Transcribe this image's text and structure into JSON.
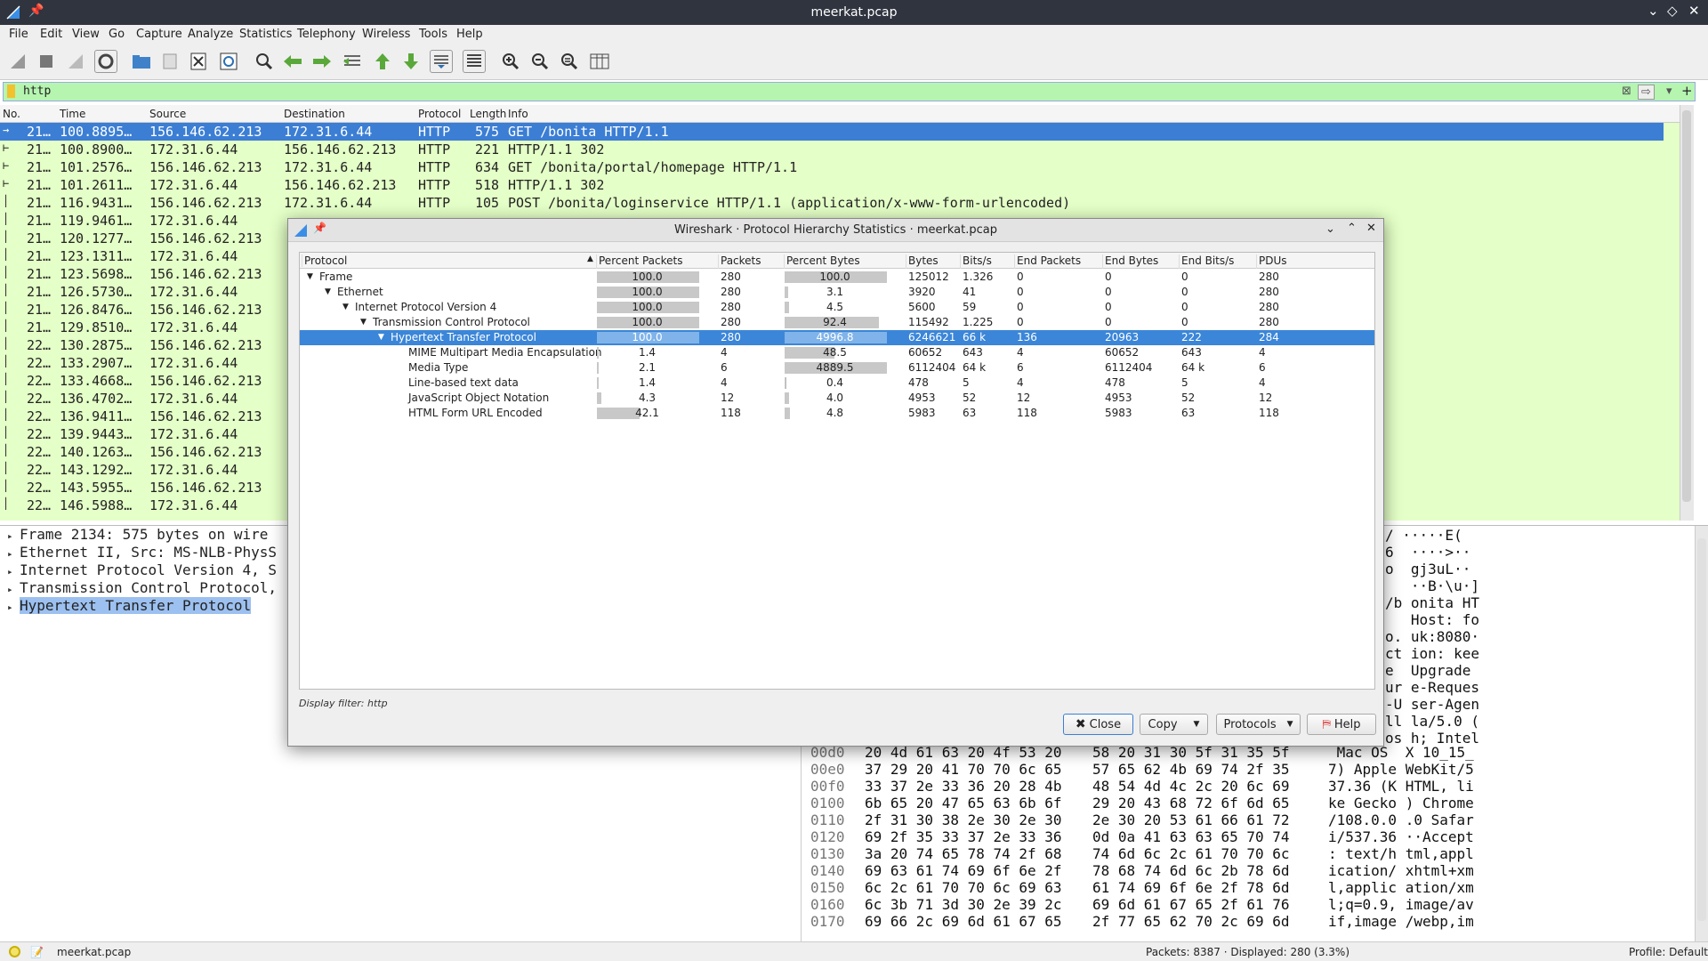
{
  "window": {
    "title": "meerkat.pcap"
  },
  "menu": [
    "File",
    "Edit",
    "View",
    "Go",
    "Capture",
    "Analyze",
    "Statistics",
    "Telephony",
    "Wireless",
    "Tools",
    "Help"
  ],
  "filter": {
    "value": "http"
  },
  "packet_list": {
    "columns": [
      "No.",
      "Time",
      "Source",
      "Destination",
      "Protocol",
      "Length",
      "Info"
    ],
    "rows": [
      {
        "no": "21…",
        "time": "100.8895…",
        "src": "156.146.62.213",
        "dst": "172.31.6.44",
        "proto": "HTTP",
        "len": "575",
        "info": "GET /bonita HTTP/1.1"
      },
      {
        "no": "21…",
        "time": "100.8900…",
        "src": "172.31.6.44",
        "dst": "156.146.62.213",
        "proto": "HTTP",
        "len": "221",
        "info": "HTTP/1.1 302"
      },
      {
        "no": "21…",
        "time": "101.2576…",
        "src": "156.146.62.213",
        "dst": "172.31.6.44",
        "proto": "HTTP",
        "len": "634",
        "info": "GET /bonita/portal/homepage HTTP/1.1"
      },
      {
        "no": "21…",
        "time": "101.2611…",
        "src": "172.31.6.44",
        "dst": "156.146.62.213",
        "proto": "HTTP",
        "len": "518",
        "info": "HTTP/1.1 302"
      },
      {
        "no": "21…",
        "time": "116.9431…",
        "src": "156.146.62.213",
        "dst": "172.31.6.44",
        "proto": "HTTP",
        "len": "105",
        "info": "POST /bonita/loginservice HTTP/1.1  (application/x-www-form-urlencoded)"
      },
      {
        "no": "21…",
        "time": "119.9461…",
        "src": "172.31.6.44",
        "dst": "",
        "proto": "",
        "len": "",
        "info": ""
      },
      {
        "no": "21…",
        "time": "120.1277…",
        "src": "156.146.62.213",
        "dst": "",
        "proto": "",
        "len": "",
        "info": ""
      },
      {
        "no": "21…",
        "time": "123.1311…",
        "src": "172.31.6.44",
        "dst": "",
        "proto": "",
        "len": "",
        "info": ""
      },
      {
        "no": "21…",
        "time": "123.5698…",
        "src": "156.146.62.213",
        "dst": "",
        "proto": "",
        "len": "",
        "info": ""
      },
      {
        "no": "21…",
        "time": "126.5730…",
        "src": "172.31.6.44",
        "dst": "",
        "proto": "",
        "len": "",
        "info": ""
      },
      {
        "no": "21…",
        "time": "126.8476…",
        "src": "156.146.62.213",
        "dst": "",
        "proto": "",
        "len": "",
        "info": ""
      },
      {
        "no": "21…",
        "time": "129.8510…",
        "src": "172.31.6.44",
        "dst": "",
        "proto": "",
        "len": "",
        "info": ""
      },
      {
        "no": "22…",
        "time": "130.2875…",
        "src": "156.146.62.213",
        "dst": "",
        "proto": "",
        "len": "",
        "info": ""
      },
      {
        "no": "22…",
        "time": "133.2907…",
        "src": "172.31.6.44",
        "dst": "",
        "proto": "",
        "len": "",
        "info": ""
      },
      {
        "no": "22…",
        "time": "133.4668…",
        "src": "156.146.62.213",
        "dst": "",
        "proto": "",
        "len": "",
        "info": ""
      },
      {
        "no": "22…",
        "time": "136.4702…",
        "src": "172.31.6.44",
        "dst": "",
        "proto": "",
        "len": "",
        "info": ""
      },
      {
        "no": "22…",
        "time": "136.9411…",
        "src": "156.146.62.213",
        "dst": "",
        "proto": "",
        "len": "",
        "info": ""
      },
      {
        "no": "22…",
        "time": "139.9443…",
        "src": "172.31.6.44",
        "dst": "",
        "proto": "",
        "len": "",
        "info": ""
      },
      {
        "no": "22…",
        "time": "140.1263…",
        "src": "156.146.62.213",
        "dst": "",
        "proto": "",
        "len": "",
        "info": ""
      },
      {
        "no": "22…",
        "time": "143.1292…",
        "src": "172.31.6.44",
        "dst": "",
        "proto": "",
        "len": "",
        "info": ""
      },
      {
        "no": "22…",
        "time": "143.5955…",
        "src": "156.146.62.213",
        "dst": "",
        "proto": "",
        "len": "",
        "info": ""
      },
      {
        "no": "22…",
        "time": "146.5988…",
        "src": "172.31.6.44",
        "dst": "",
        "proto": "",
        "len": "",
        "info": ""
      }
    ]
  },
  "details": [
    "Frame 2134: 575 bytes on wire",
    "Ethernet II, Src: MS-NLB-PhysS",
    "Internet Protocol Version 4, S",
    "Transmission Control Protocol,",
    "Hypertext Transfer Protocol"
  ],
  "hex_partial": [
    {
      "ascii": "/ ·····E("
    },
    {
      "ascii": "6  ····>··"
    },
    {
      "ascii": "o  gj3uL··"
    },
    {
      "ascii": "   ··B·\\u·]"
    },
    {
      "ascii": "/b onita HT"
    },
    {
      "ascii": "   Host: fo"
    },
    {
      "ascii": "o. uk:8080·"
    },
    {
      "ascii": "ct ion: kee"
    },
    {
      "ascii": "e  Upgrade"
    },
    {
      "ascii": "ur e-Reques"
    },
    {
      "ascii": "-U ser-Agen"
    },
    {
      "ascii": "ll la/5.0 ("
    },
    {
      "ascii": "os h; Intel"
    }
  ],
  "hex": [
    {
      "off": "00d0",
      "b1": "20 4d 61 63 20 4f 53 20",
      "b2": "58 20 31 30 5f 31 35 5f",
      "ascii": " Mac OS  X 10_15_"
    },
    {
      "off": "00e0",
      "b1": "37 29 20 41 70 70 6c 65",
      "b2": "57 65 62 4b 69 74 2f 35",
      "ascii": "7) Apple WebKit/5"
    },
    {
      "off": "00f0",
      "b1": "33 37 2e 33 36 20 28 4b",
      "b2": "48 54 4d 4c 2c 20 6c 69",
      "ascii": "37.36 (K HTML, li"
    },
    {
      "off": "0100",
      "b1": "6b 65 20 47 65 63 6b 6f",
      "b2": "29 20 43 68 72 6f 6d 65",
      "ascii": "ke Gecko ) Chrome"
    },
    {
      "off": "0110",
      "b1": "2f 31 30 38 2e 30 2e 30",
      "b2": "2e 30 20 53 61 66 61 72",
      "ascii": "/108.0.0 .0 Safar"
    },
    {
      "off": "0120",
      "b1": "69 2f 35 33 37 2e 33 36",
      "b2": "0d 0a 41 63 63 65 70 74",
      "ascii": "i/537.36 ··Accept"
    },
    {
      "off": "0130",
      "b1": "3a 20 74 65 78 74 2f 68",
      "b2": "74 6d 6c 2c 61 70 70 6c",
      "ascii": ": text/h tml,appl"
    },
    {
      "off": "0140",
      "b1": "69 63 61 74 69 6f 6e 2f",
      "b2": "78 68 74 6d 6c 2b 78 6d",
      "ascii": "ication/ xhtml+xm"
    },
    {
      "off": "0150",
      "b1": "6c 2c 61 70 70 6c 69 63",
      "b2": "61 74 69 6f 6e 2f 78 6d",
      "ascii": "l,applic ation/xm"
    },
    {
      "off": "0160",
      "b1": "6c 3b 71 3d 30 2e 39 2c",
      "b2": "69 6d 61 67 65 2f 61 76",
      "ascii": "l;q=0.9, image/av"
    },
    {
      "off": "0170",
      "b1": "69 66 2c 69 6d 61 67 65",
      "b2": "2f 77 65 62 70 2c 69 6d",
      "ascii": "if,image /webp,im"
    }
  ],
  "statusbar": {
    "file": "meerkat.pcap",
    "packets": "Packets: 8387 · Displayed: 280 (3.3%)",
    "profile": "Profile: Default"
  },
  "dialog": {
    "title": "Wireshark · Protocol Hierarchy Statistics · meerkat.pcap",
    "columns": [
      "Protocol",
      "Percent Packets",
      "Packets",
      "Percent Bytes",
      "Bytes",
      "Bits/s",
      "End Packets",
      "End Bytes",
      "End Bits/s",
      "PDUs"
    ],
    "rows": [
      {
        "name": "Frame",
        "pp": "100.0",
        "pp_v": 100,
        "pk": "280",
        "pb": "100.0",
        "pb_v": 100,
        "by": "125012",
        "bs": "1.326",
        "ep": "0",
        "eb": "0",
        "ebs": "0",
        "pdu": "280"
      },
      {
        "name": "Ethernet",
        "pp": "100.0",
        "pp_v": 100,
        "pk": "280",
        "pb": "3.1",
        "pb_v": 3.1,
        "by": "3920",
        "bs": "41",
        "ep": "0",
        "eb": "0",
        "ebs": "0",
        "pdu": "280"
      },
      {
        "name": "Internet Protocol Version 4",
        "pp": "100.0",
        "pp_v": 100,
        "pk": "280",
        "pb": "4.5",
        "pb_v": 4.5,
        "by": "5600",
        "bs": "59",
        "ep": "0",
        "eb": "0",
        "ebs": "0",
        "pdu": "280"
      },
      {
        "name": "Transmission Control Protocol",
        "pp": "100.0",
        "pp_v": 100,
        "pk": "280",
        "pb": "92.4",
        "pb_v": 92.4,
        "by": "115492",
        "bs": "1.225",
        "ep": "0",
        "eb": "0",
        "ebs": "0",
        "pdu": "280"
      },
      {
        "name": "Hypertext Transfer Protocol",
        "pp": "100.0",
        "pp_v": 100,
        "pk": "280",
        "pb": "4996.8",
        "pb_v": 100,
        "by": "6246621",
        "bs": "66 k",
        "ep": "136",
        "eb": "20963",
        "ebs": "222",
        "pdu": "284"
      },
      {
        "name": "MIME Multipart Media Encapsulation",
        "pp": "1.4",
        "pp_v": 1.4,
        "pk": "4",
        "pb": "48.5",
        "pb_v": 48.5,
        "by": "60652",
        "bs": "643",
        "ep": "4",
        "eb": "60652",
        "ebs": "643",
        "pdu": "4"
      },
      {
        "name": "Media Type",
        "pp": "2.1",
        "pp_v": 2.1,
        "pk": "6",
        "pb": "4889.5",
        "pb_v": 100,
        "by": "6112404",
        "bs": "64 k",
        "ep": "6",
        "eb": "6112404",
        "ebs": "64 k",
        "pdu": "6"
      },
      {
        "name": "Line-based text data",
        "pp": "1.4",
        "pp_v": 1.4,
        "pk": "4",
        "pb": "0.4",
        "pb_v": 0.4,
        "by": "478",
        "bs": "5",
        "ep": "4",
        "eb": "478",
        "ebs": "5",
        "pdu": "4"
      },
      {
        "name": "JavaScript Object Notation",
        "pp": "4.3",
        "pp_v": 4.3,
        "pk": "12",
        "pb": "4.0",
        "pb_v": 4.0,
        "by": "4953",
        "bs": "52",
        "ep": "12",
        "eb": "4953",
        "ebs": "52",
        "pdu": "12"
      },
      {
        "name": "HTML Form URL Encoded",
        "pp": "42.1",
        "pp_v": 42.1,
        "pk": "118",
        "pb": "4.8",
        "pb_v": 4.8,
        "by": "5983",
        "bs": "63",
        "ep": "118",
        "eb": "5983",
        "ebs": "63",
        "pdu": "118"
      }
    ],
    "display_filter": "Display filter: http",
    "buttons": {
      "close": "Close",
      "copy": "Copy",
      "protocols": "Protocols",
      "help": "Help"
    }
  }
}
